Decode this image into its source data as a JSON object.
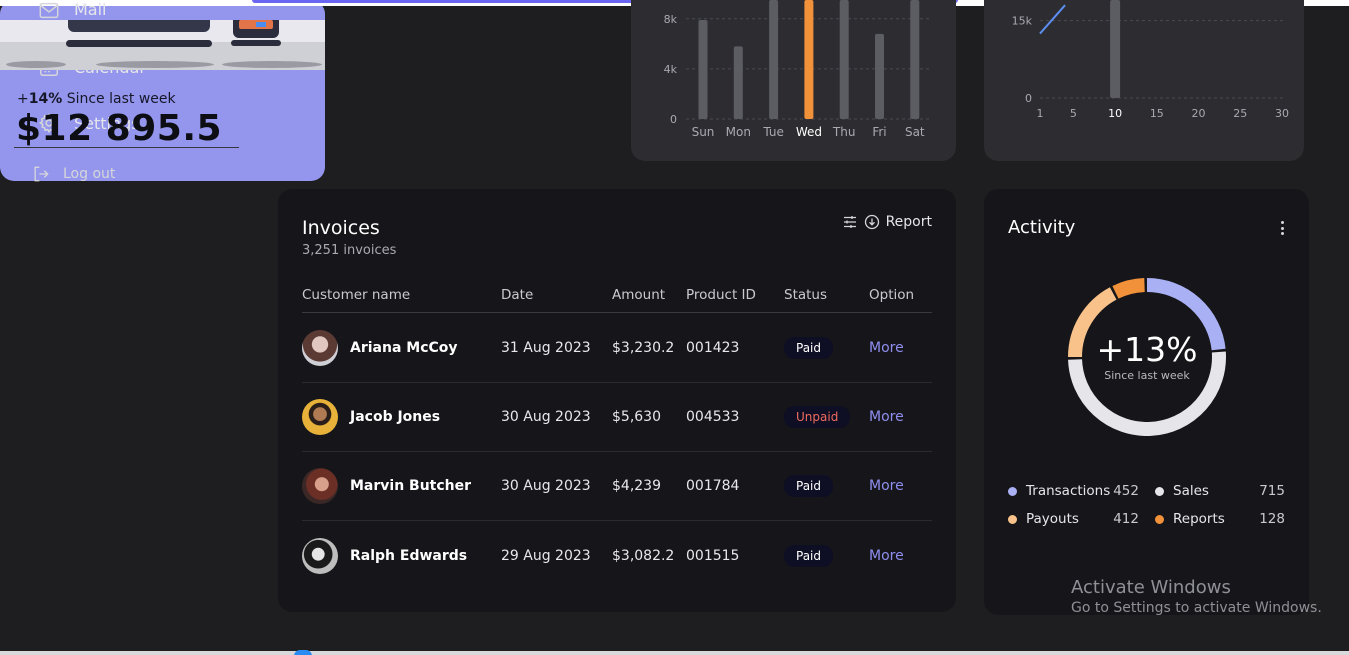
{
  "sidebar": {
    "items": [
      {
        "label": "Mail",
        "icon": "mail-icon"
      },
      {
        "label": "Calendar",
        "icon": "calendar-icon"
      },
      {
        "label": "Settings",
        "icon": "gear-icon"
      }
    ],
    "logout_label": "Log out"
  },
  "revenue_card": {
    "change_prefix": "+",
    "change": "14%",
    "since": "Since last week",
    "amount": "$12 895.5",
    "accent": "#9396ec"
  },
  "chart_data": [
    {
      "type": "bar",
      "categories": [
        "Sun",
        "Mon",
        "Tue",
        "Wed",
        "Thu",
        "Fri",
        "Sat"
      ],
      "highlight": "Wed",
      "values": [
        7.9,
        5.8,
        9.5,
        9.5,
        9.5,
        6.8,
        9.5
      ],
      "yticks": [
        "0",
        "4k",
        "8k"
      ],
      "ylim": [
        0,
        9.5
      ],
      "grid": true,
      "colors": {
        "bar": "#5c5c63",
        "highlight": "#f1913a"
      }
    },
    {
      "type": "line",
      "xticks": [
        "1",
        "5",
        "10",
        "15",
        "20",
        "25",
        "30"
      ],
      "highlight_tick": "10",
      "yticks": [
        "0",
        "15k"
      ],
      "ylim": [
        0,
        19
      ],
      "line_points": [
        [
          1,
          12.5
        ],
        [
          4,
          18
        ]
      ],
      "bar_at": 10,
      "bar_value": 19,
      "grid": true,
      "colors": {
        "line": "#5b8ef0",
        "bar": "#5c5c63"
      }
    }
  ],
  "invoices": {
    "title": "Invoices",
    "subtitle": "3,251 invoices",
    "report_label": "Report",
    "headers": [
      "Customer name",
      "Date",
      "Amount",
      "Product ID",
      "Status",
      "Option"
    ],
    "rows": [
      {
        "name": "Ariana McCoy",
        "date": "31 Aug 2023",
        "amount": "$3,230.2",
        "pid": "001423",
        "status": "Paid",
        "option": "More"
      },
      {
        "name": "Jacob Jones",
        "date": "30 Aug 2023",
        "amount": "$5,630",
        "pid": "004533",
        "status": "Unpaid",
        "option": "More"
      },
      {
        "name": "Marvin Butcher",
        "date": "30 Aug 2023",
        "amount": "$4,239",
        "pid": "001784",
        "status": "Paid",
        "option": "More"
      },
      {
        "name": "Ralph Edwards",
        "date": "29 Aug 2023",
        "amount": "$3,082.2",
        "pid": "001515",
        "status": "Paid",
        "option": "More"
      }
    ]
  },
  "activity": {
    "title": "Activity",
    "percent": "+13%",
    "since": "Since last week",
    "legend": [
      {
        "label": "Transactions",
        "value": "452",
        "color": "#a9b0f4"
      },
      {
        "label": "Sales",
        "value": "715",
        "color": "#e6e6ea"
      },
      {
        "label": "Payouts",
        "value": "412",
        "color": "#f8c28a"
      },
      {
        "label": "Reports",
        "value": "128",
        "color": "#f1913a"
      }
    ]
  },
  "watermark": {
    "line1": "Activate Windows",
    "line2": "Go to Settings to activate Windows."
  }
}
